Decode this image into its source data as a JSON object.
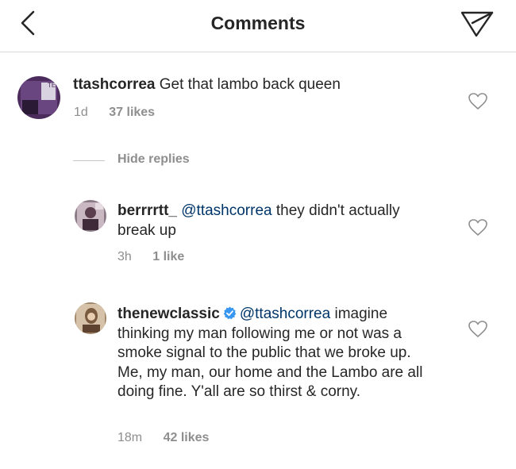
{
  "header": {
    "title": "Comments",
    "back_icon": "chevron-left-icon",
    "send_icon": "paper-plane-icon"
  },
  "comments": [
    {
      "username": "ttashcorrea",
      "text": "Get that lambo back queen",
      "time": "1d",
      "likes": "37 likes",
      "avatar_color": "#5b3a6b"
    }
  ],
  "hide_replies": "Hide replies",
  "replies": [
    {
      "username": "berrrrtt_",
      "mention": "@ttashcorrea",
      "text": "they didn't actually break up",
      "time": "3h",
      "likes": "1 like"
    },
    {
      "username": "thenewclassic",
      "verified": true,
      "mention": "@ttashcorrea",
      "text": "imagine thinking my man following me or not was a smoke signal to the public that we broke up. Me, my man, our home and the Lambo are all doing fine. Y'all are so thirst & corny.",
      "time": "18m",
      "likes": "42 likes"
    }
  ],
  "colors": {
    "text": "#262626",
    "secondary": "#8e8e8e",
    "mention": "#003569",
    "verified": "#3897f0",
    "divider": "#dbdbdb"
  }
}
